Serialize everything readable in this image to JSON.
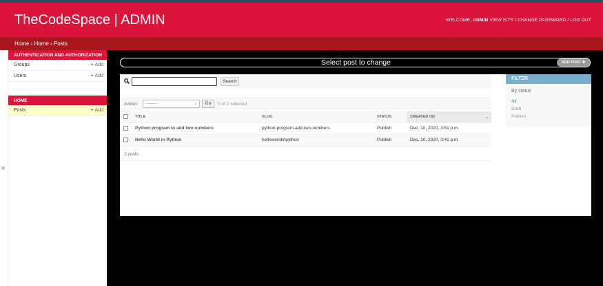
{
  "header": {
    "brand": "TheCodeSpace | ADMIN",
    "welcome": "WELCOME,",
    "username": "ADMIN",
    "view_site": "VIEW SITE",
    "change_password": "CHANGE PASSWORD",
    "log_out": "LOG OUT",
    "sep": "/"
  },
  "breadcrumbs": "Home › Home › Posts",
  "sidebar": {
    "collapse_glyph": "«",
    "modules": [
      {
        "heading": "AUTHENTICATION AND AUTHORIZATION",
        "rows": [
          {
            "name": "Groups",
            "add": "Add"
          },
          {
            "name": "Users",
            "add": "Add"
          }
        ]
      },
      {
        "heading": "HOME",
        "rows": [
          {
            "name": "Posts",
            "add": "Add"
          }
        ]
      }
    ]
  },
  "content": {
    "title": "Select post to change",
    "add_button": "ADD POST"
  },
  "search": {
    "value": "",
    "button": "Search"
  },
  "actions": {
    "label": "Action:",
    "selected": "---------",
    "go": "Go",
    "count": "0 of 2 selected"
  },
  "table": {
    "columns": [
      "TITLE",
      "SLUG",
      "STATUS",
      "CREATED ON"
    ],
    "rows": [
      {
        "title": "Python program to add two numbers",
        "slug": "python-program-add-two-numbers",
        "status": "Publish",
        "created": "Dec. 10, 2020, 3:51 p.m."
      },
      {
        "title": "Hello World in Python",
        "slug": "helloworldinpython",
        "status": "Publish",
        "created": "Dec. 10, 2020, 3:41 p.m."
      }
    ]
  },
  "paginator": "2 posts",
  "filter": {
    "heading": "FILTER",
    "by": "By status",
    "options": [
      "All",
      "Draft",
      "Publish"
    ],
    "selected": "All"
  },
  "colors": {
    "header": "#dc143c",
    "breadcrumbs": "#a8171b",
    "filter_heading": "#79aec8",
    "selected_row": "#ffffcc"
  }
}
